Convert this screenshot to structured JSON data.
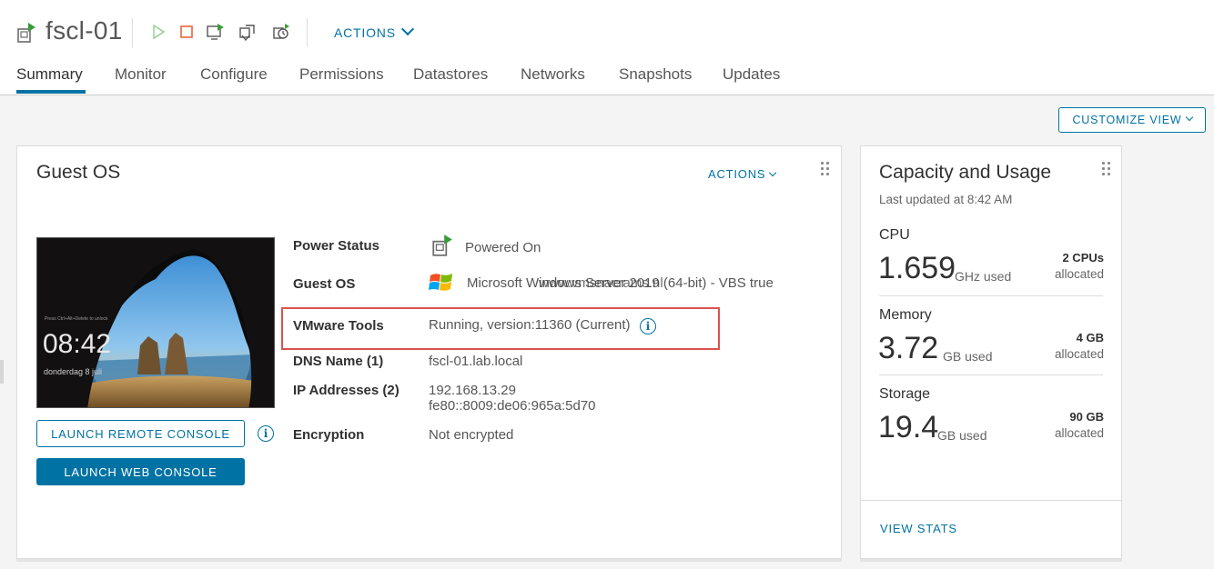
{
  "vm": {
    "name": "fscl-01"
  },
  "toolbar": {
    "actions_label": "ACTIONS"
  },
  "tabs": [
    {
      "label": "Summary",
      "active": true
    },
    {
      "label": "Monitor"
    },
    {
      "label": "Configure"
    },
    {
      "label": "Permissions"
    },
    {
      "label": "Datastores"
    },
    {
      "label": "Networks"
    },
    {
      "label": "Snapshots"
    },
    {
      "label": "Updates"
    }
  ],
  "customize_label": "CUSTOMIZE VIEW",
  "guest_os_card": {
    "title": "Guest OS",
    "actions_label": "ACTIONS",
    "console": {
      "clock": "08:42",
      "date": "donderdag 8 juli"
    },
    "launch_remote_label": "LAUNCH REMOTE CONSOLE",
    "launch_web_label": "LAUNCH WEB CONSOLE",
    "properties": [
      {
        "label": "Power Status",
        "value": "Powered On"
      },
      {
        "label": "Guest OS",
        "value": "Microsoft Windows Server 2019 (64-bit) - VBS true"
      },
      {
        "label": "VMware Tools",
        "value": "Running, version:11360 (Current)"
      },
      {
        "label": "DNS Name (1)",
        "value": "fscl-01.lab.local"
      },
      {
        "label": "IP Addresses (2)",
        "value": "192.168.13.29",
        "value2": "fe80::8009:de06:965a:5d70"
      },
      {
        "label": "Encryption",
        "value": "Not encrypted"
      }
    ],
    "watermark": "www.vmsnacrams.nl"
  },
  "capacity_card": {
    "title": "Capacity and Usage",
    "last_updated": "Last updated at 8:42 AM",
    "resources": [
      {
        "name": "CPU",
        "used": "1.659",
        "unit": "GHz used",
        "alloc": "2 CPUs",
        "alloc_label": "allocated"
      },
      {
        "name": "Memory",
        "used": "3.72",
        "unit": "GB used",
        "alloc": "4 GB",
        "alloc_label": "allocated"
      },
      {
        "name": "Storage",
        "used": "19.4",
        "unit": "GB used",
        "alloc": "90 GB",
        "alloc_label": "allocated"
      }
    ],
    "view_stats_label": "VIEW STATS"
  },
  "colors": {
    "accent": "#0072a3",
    "highlight": "#d9534f",
    "power_on": "#3c9a3c",
    "stop": "#e8663d"
  }
}
